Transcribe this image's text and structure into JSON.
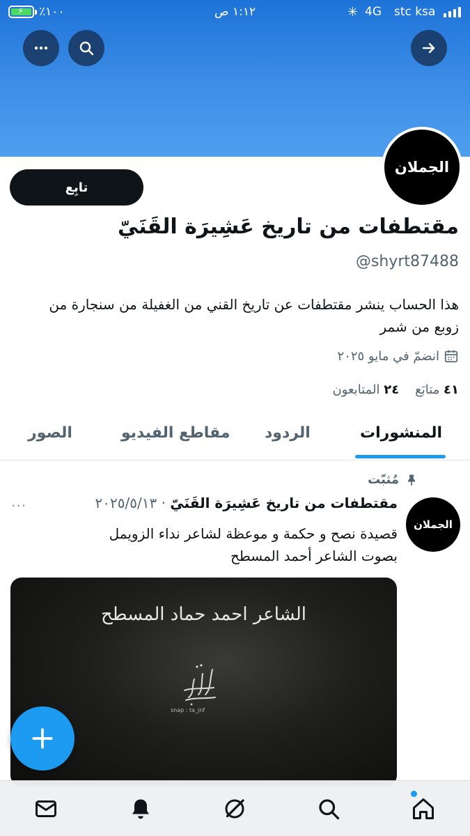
{
  "status_bar": {
    "battery": "٪١٠٠",
    "time": "١:١٢ ص",
    "network": "4G",
    "carrier": "stc ksa"
  },
  "profile": {
    "avatar_text": "الجملان",
    "follow_label": "تابِع",
    "name": "مقتطفات من تاريخ عَشِيرَة القَنَيّ",
    "handle": "@shyrt87488",
    "bio": "هذا الحساب ينشر مقتطفات عن تاريخ القني من الغفيلة من سنجارة من زوبع من شمر",
    "joined": "انضمّ في مايو ٢٠٢٥",
    "following_count": "٤١",
    "following_label": "متابَع",
    "followers_count": "٢٤",
    "followers_label": "المتابعون"
  },
  "tabs": [
    {
      "label": "المنشورات",
      "active": true
    },
    {
      "label": "الردود"
    },
    {
      "label": "مقاطع الفيديو"
    },
    {
      "label": "الصور"
    }
  ],
  "post": {
    "pinned_label": "مُثبّت",
    "avatar_text": "الجملان",
    "author": "مقتطفات من تاريخ عَشِيرَة القَنَيّ",
    "date": "· ٢٠٢٥/٥/١٣",
    "more": "···",
    "text": "قصيدة نصح و حكمة و موعظة لشاعر نداء الزويمل بصوت الشاعر أحمد المسطح",
    "media_title": "الشاعر احمد حماد المسطح",
    "media_caption": "snap : ta_jnf"
  },
  "nav": [
    "mail-icon",
    "bell-icon",
    "spaces-icon",
    "search-icon",
    "home-icon"
  ],
  "colors": {
    "accent": "#1d9bf0",
    "banner": "#3d8ee6",
    "text": "#0f1419",
    "muted": "#536471"
  }
}
